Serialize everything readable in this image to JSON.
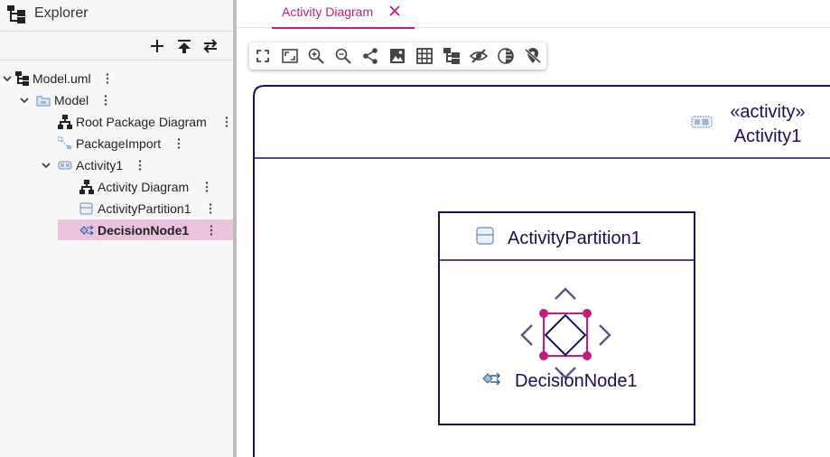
{
  "explorer": {
    "title": "Explorer",
    "toolbar": [
      "add-icon",
      "collapse-all-icon",
      "sync-icon"
    ],
    "tree": [
      {
        "label": "Model.uml",
        "icon": "model-file-icon",
        "expanded": true,
        "level": 0
      },
      {
        "label": "Model",
        "icon": "package-icon",
        "expanded": true,
        "level": 1
      },
      {
        "label": "Root Package Diagram",
        "icon": "diagram-icon",
        "level": 2
      },
      {
        "label": "PackageImport",
        "icon": "package-import-icon",
        "level": 2
      },
      {
        "label": "Activity1",
        "icon": "activity-icon",
        "expanded": true,
        "level": 2
      },
      {
        "label": "Activity Diagram",
        "icon": "diagram-icon",
        "level": 3
      },
      {
        "label": "ActivityPartition1",
        "icon": "partition-icon",
        "level": 3
      },
      {
        "label": "DecisionNode1",
        "icon": "decision-node-icon",
        "level": 3,
        "selected": true
      }
    ]
  },
  "tabs": [
    {
      "label": "Activity Diagram",
      "active": true
    }
  ],
  "diagram_toolbar": [
    "fit-screen-icon",
    "fit-window-icon",
    "zoom-in-icon",
    "zoom-out-icon",
    "share-icon",
    "export-image-icon",
    "grid-icon",
    "layout-icon",
    "hide-icon",
    "contrast-icon",
    "location-off-icon"
  ],
  "diagram": {
    "activity": {
      "stereotype": "«activity»",
      "name": "Activity1"
    },
    "partition": {
      "name": "ActivityPartition1"
    },
    "decision": {
      "name": "DecisionNode1"
    }
  },
  "colors": {
    "accent": "#c51b7d",
    "diagram_stroke": "#1b0d5e",
    "selection_bg": "#ebc3dd"
  }
}
